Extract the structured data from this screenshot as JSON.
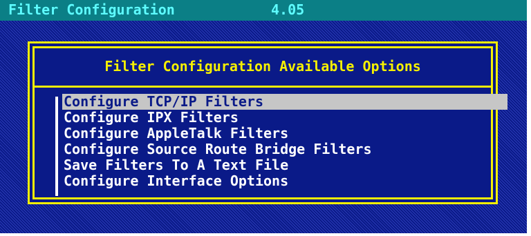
{
  "window": {
    "title": "Filter Configuration",
    "version": "4.05"
  },
  "dialog": {
    "title": "Filter Configuration Available Options",
    "options": [
      {
        "label": "Configure TCP/IP Filters",
        "selected": true
      },
      {
        "label": "Configure IPX Filters",
        "selected": false
      },
      {
        "label": "Configure AppleTalk Filters",
        "selected": false
      },
      {
        "label": "Configure Source Route Bridge Filters",
        "selected": false
      },
      {
        "label": "Save Filters To A Text File",
        "selected": false
      },
      {
        "label": "Configure Interface Options",
        "selected": false
      }
    ]
  },
  "colors": {
    "screen_background": "#0a1a88",
    "title_bar": "#0b7f86",
    "title_text": "#5efcff",
    "dialog_border": "#f6f000",
    "highlight": "#c6c6c6",
    "menu_text": "#ffffff"
  }
}
